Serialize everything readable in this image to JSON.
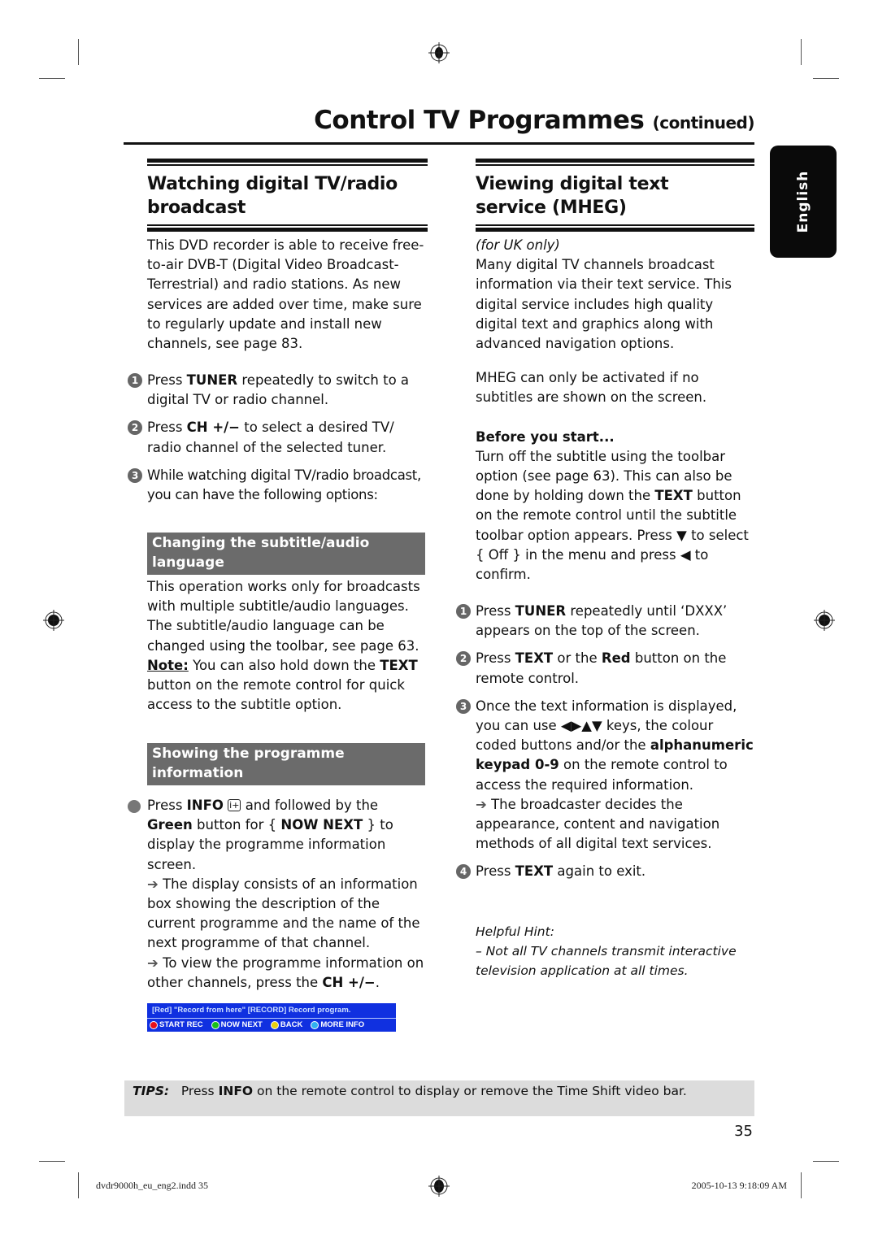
{
  "header": {
    "title": "Control TV Programmes",
    "title_suffix": "(continued)"
  },
  "language_tab": "English",
  "left": {
    "heading": "Watching digital TV/radio broadcast",
    "intro": "This DVD recorder is able to receive free-to-air DVB-T (Digital Video Broadcast-Terrestrial) and radio stations. As new services are added over time, make sure to regularly update and install new channels, see page 83.",
    "steps": [
      {
        "num": "1",
        "pre": "Press ",
        "bold": "TUNER",
        "post": " repeatedly to switch to a digital TV or radio channel."
      },
      {
        "num": "2",
        "pre": "Press ",
        "bold": "CH +/−",
        "post": " to select a desired TV/ radio channel of the selected tuner."
      },
      {
        "num": "3",
        "pre": "While watching digital TV/radio broadcast, you can have the following options:",
        "bold": "",
        "post": ""
      }
    ],
    "subsection1": {
      "heading": "Changing the subtitle/audio language",
      "body": "This operation works only for broadcasts with multiple subtitle/audio languages. The subtitle/audio language can be changed using the toolbar, see page 63.",
      "note_label": "Note:",
      "note_pre": " You can also hold down the ",
      "note_bold": "TEXT",
      "note_post": " button on the remote control for quick access to the subtitle option."
    },
    "subsection2": {
      "heading": "Showing the programme information",
      "bullet_pre": "Press ",
      "bullet_bold1": "INFO",
      "info_icon": "i+",
      "bullet_mid": " and followed by the ",
      "bullet_bold2": "Green",
      "bullet_mid2": " button for { ",
      "bullet_bold3": "NOW NEXT",
      "bullet_post": " } to display the programme information screen.",
      "result1": "The display consists of an information box showing the description of the current programme and the name of the next programme of that channel.",
      "result2_pre": "To view the programme information on other channels, press the ",
      "result2_bold": "CH +/−",
      "result2_post": "."
    },
    "osd": {
      "line1": "[Red] \"Record from here\"  [RECORD] Record program.",
      "buttons": [
        {
          "label": "START REC",
          "color": "#e8101a"
        },
        {
          "label": "NOW NEXT",
          "color": "#18c018"
        },
        {
          "label": "BACK",
          "color": "#e8d010"
        },
        {
          "label": "MORE INFO",
          "color": "#30b0f0"
        }
      ]
    }
  },
  "right": {
    "heading": "Viewing digital text service (MHEG)",
    "region_note": "(for UK only)",
    "intro": "Many digital TV channels broadcast information via their text service.  This digital service includes high quality digital text and graphics along with advanced navigation options.",
    "mheg_note": "MHEG can only be activated if no subtitles are shown on the screen.",
    "before_heading": "Before you start...",
    "before_pre": "Turn off the subtitle using the toolbar option (see page 63).  This can also be done by holding down the ",
    "before_bold": "TEXT",
    "before_mid": " button on the remote control until the subtitle toolbar option appears.  Press ▼ to select { Off } in the menu and press ◀ to confirm.",
    "steps": [
      {
        "num": "1",
        "pre": "Press ",
        "bold": "TUNER",
        "post": " repeatedly until ‘DXXX’ appears on the top of the screen."
      },
      {
        "num": "2",
        "pre": "Press ",
        "bold": "TEXT",
        "mid": " or the ",
        "bold2": "Red",
        "post": " button on the remote control."
      },
      {
        "num": "3",
        "pre": "Once the text information is displayed, you can use ◀▶▲▼ keys, the colour coded buttons and/or the ",
        "bold": "alphanumeric keypad 0-9",
        "post": " on the remote control to access the required information.",
        "result": "The broadcaster decides the appearance, content and navigation methods of all digital text services."
      },
      {
        "num": "4",
        "pre": "Press ",
        "bold": "TEXT",
        "post": " again to exit."
      }
    ],
    "hint_title": "Helpful Hint:",
    "hint_body": "–  Not all TV channels transmit interactive television application at all times."
  },
  "tips": {
    "label": "TIPS:",
    "pre": "Press ",
    "bold": "INFO",
    "post": " on the remote control to display or remove the Time Shift video bar."
  },
  "page_number": "35",
  "slug": {
    "file": "dvdr9000h_eu_eng2.indd   35",
    "timestamp": "2005-10-13   9:18:09 AM"
  }
}
